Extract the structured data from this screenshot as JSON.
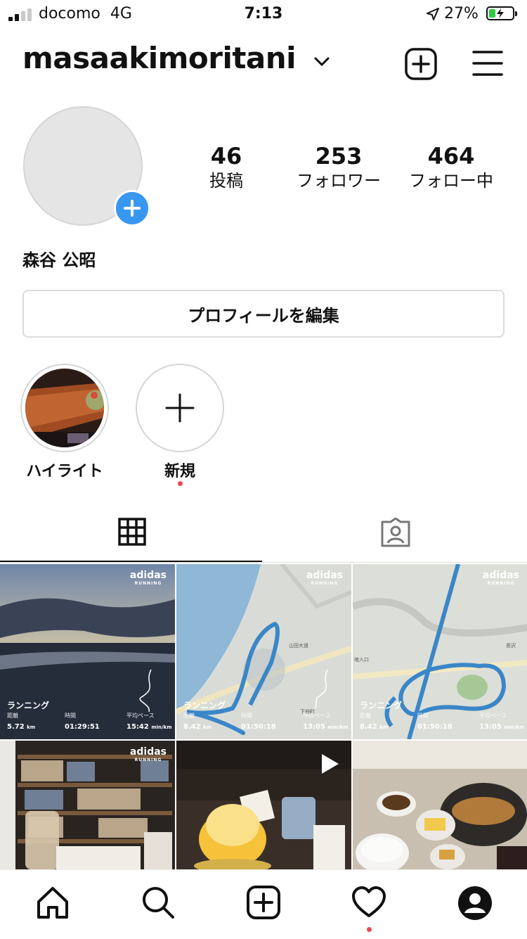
{
  "status_bar": {
    "carrier": "docomo",
    "network": "4G",
    "time": "7:13",
    "battery": "27%"
  },
  "header": {
    "username": "masaakimoritani"
  },
  "profile": {
    "posts_count": "46",
    "posts_label": "投稿",
    "followers_count": "253",
    "followers_label": "フォロワー",
    "following_count": "464",
    "following_label": "フォロー中",
    "full_name": "森谷 公昭",
    "edit_button": "プロフィールを編集"
  },
  "highlights": [
    {
      "label": "ハイライト"
    },
    {
      "label": "新規"
    }
  ],
  "posts": [
    {
      "badge": "adidas",
      "badge_sub": "RUNNING",
      "activity": "ランニング",
      "distance_label": "距離",
      "distance": "5.72",
      "time_label": "時間",
      "time": "01:29:51",
      "pace_label": "平均ペース",
      "pace": "15:42",
      "unit_km": "km",
      "unit_pace": "min/km"
    },
    {
      "badge": "adidas",
      "badge_sub": "RUNNING",
      "activity": "ランニング",
      "distance_label": "距離",
      "distance": "8.42",
      "time_label": "時間",
      "time": "01:50:18",
      "pace_label": "平均ペース",
      "pace": "13:05",
      "unit_km": "km",
      "unit_pace": "min/km"
    },
    {
      "badge": "adidas",
      "badge_sub": "RUNNING",
      "activity": "ランニング",
      "distance_label": "距離",
      "distance": "8.42",
      "time_label": "時間",
      "time": "01:50:18",
      "pace_label": "平均ペース",
      "pace": "13:05",
      "unit_km": "km",
      "unit_pace": "min/km"
    },
    {
      "badge": "adidas",
      "badge_sub": "RUNNING"
    }
  ],
  "map_labels": {
    "m2a": "山田大道",
    "m2b": "下府町",
    "m3a": "地入口",
    "m3b": "長沢"
  },
  "colors": {
    "accent": "#3897f0",
    "notification": "#ed4956",
    "route": "#3a86c8"
  }
}
